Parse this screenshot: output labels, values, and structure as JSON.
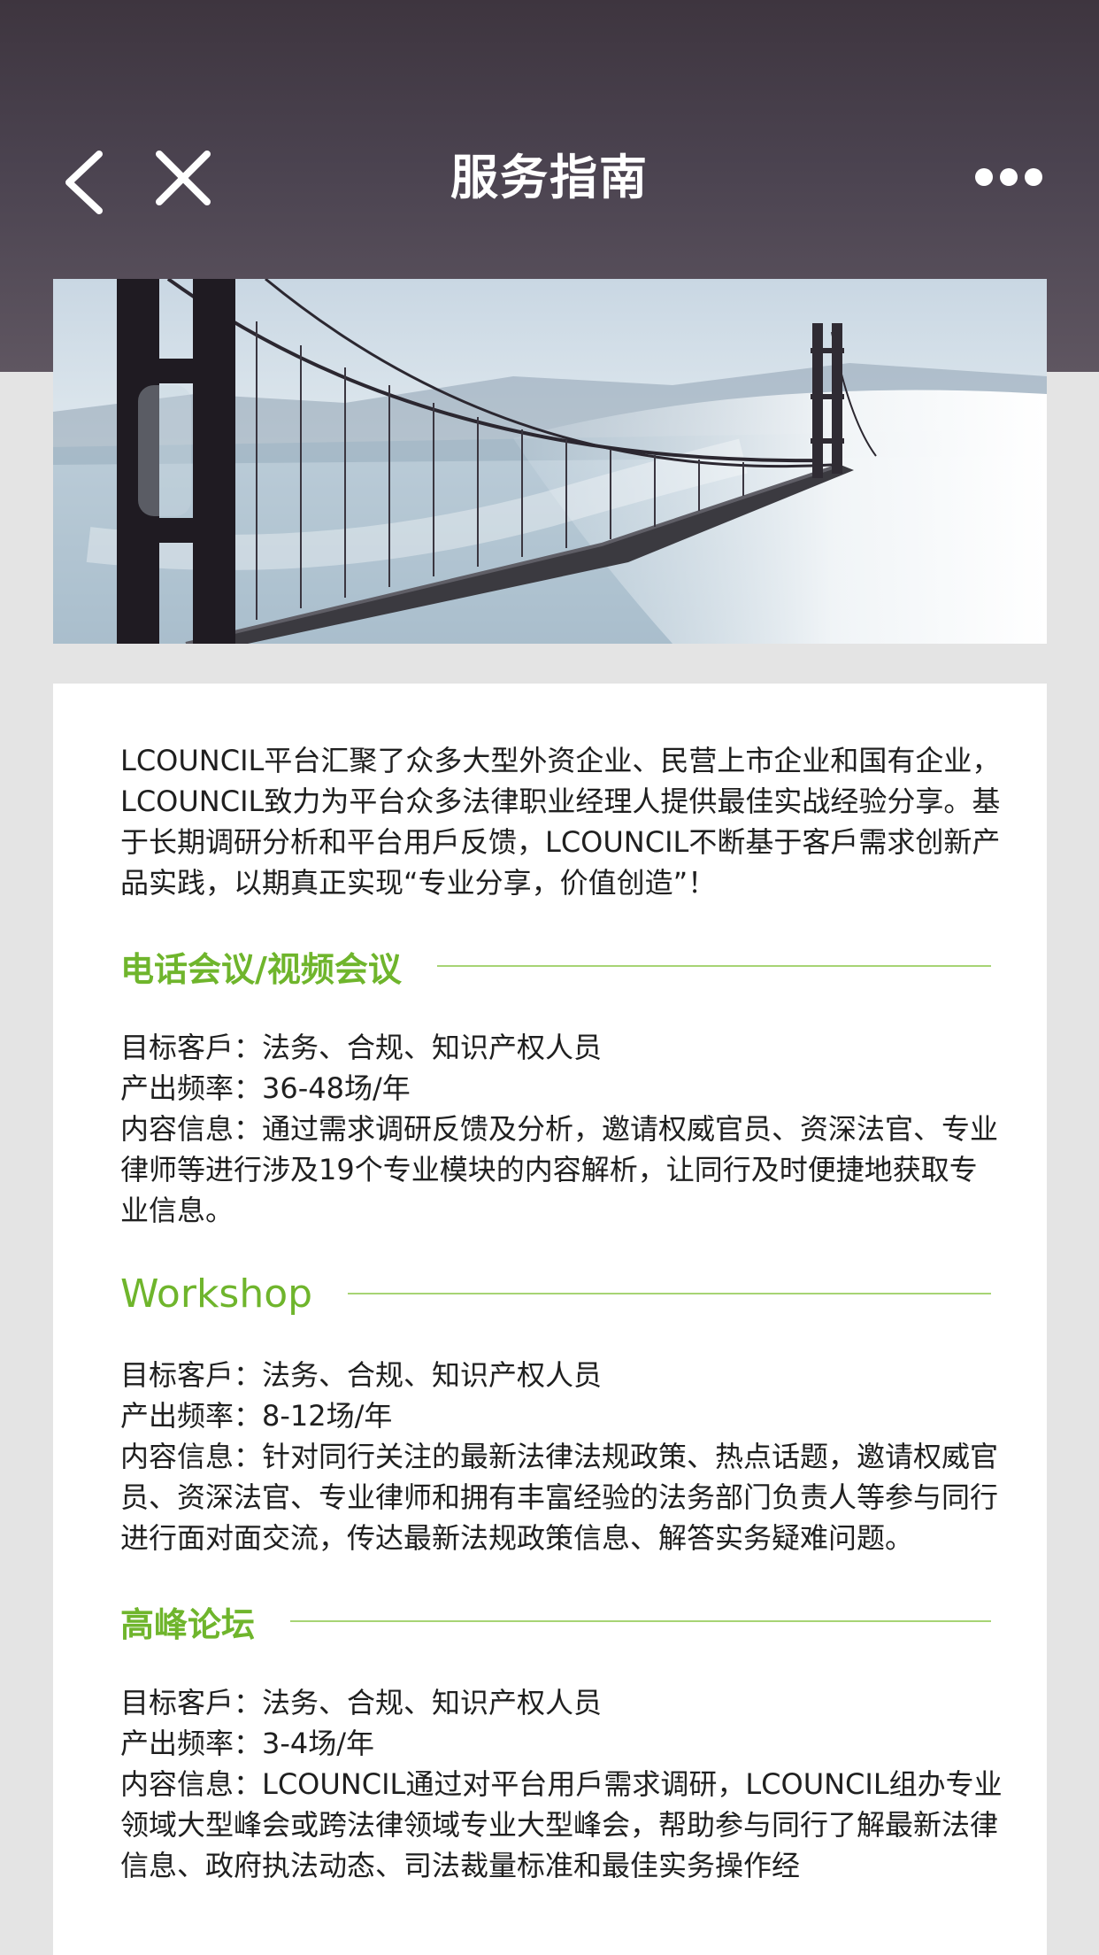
{
  "header": {
    "title": "服务指南",
    "back_icon": "chevron-left-icon",
    "close_icon": "close-icon",
    "more_icon": "more-dots-icon"
  },
  "banner": {
    "image": "bridge-in-fog-photo"
  },
  "intro": "LCOUNCIL平台汇聚了众多大型外资企业、民营上市企业和国有企业，LCOUNCIL致力为平台众多法律职业经理人提供最佳实战经验分享。基于长期调研分析和平台用戶反馈，LCOUNCIL不断基于客戶需求创新产品实践，以期真正实现“专业分享，价值创造”！",
  "sections": [
    {
      "title": "电话会议/视频会议",
      "lines": [
        "目标客戶：法务、合规、知识产权人员",
        "产出频率：36-48场/年",
        "内容信息：通过需求调研反馈及分析，邀请权威官员、资深法官、专业律师等进行涉及19个专业模块的内容解析，让同行及时便捷地获取专业信息。"
      ]
    },
    {
      "title": "Workshop",
      "lines": [
        "目标客戶：法务、合规、知识产权人员",
        "产出频率：8-12场/年",
        "内容信息：针对同行关注的最新法律法规政策、热点话题，邀请权威官员、资深法官、专业律师和拥有丰富经验的法务部门负责人等参与同行进行面对面交流，传达最新法规政策信息、解答实务疑难问题。"
      ]
    },
    {
      "title": "高峰论坛",
      "lines": [
        "目标客戶：法务、合规、知识产权人员",
        "产出频率：3-4场/年",
        "内容信息：LCOUNCIL通过对平台用戶需求调研，LCOUNCIL组办专业领域大型峰会或跨法律领域专业大型峰会，帮助参与同行了解最新法律信息、政府执法动态、司法裁量标准和最佳实务操作经"
      ]
    }
  ],
  "colors": {
    "accent": "#6fb52c",
    "accent_line": "#a7d474",
    "header_bg": "#4b4350",
    "page_bg": "#e4e4e4"
  }
}
